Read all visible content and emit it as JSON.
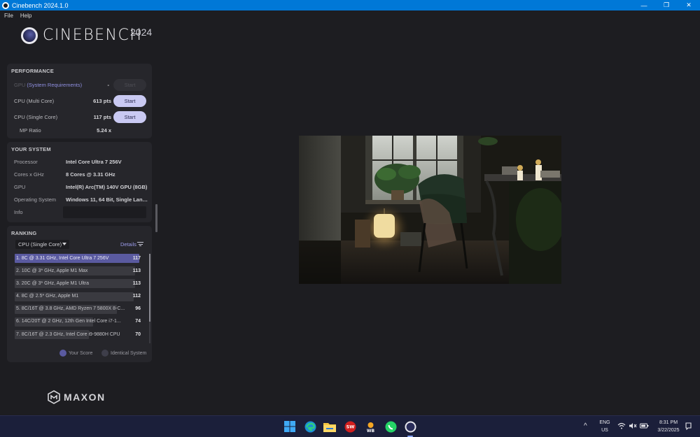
{
  "window": {
    "title": "Cinebench 2024.1.0",
    "controls": {
      "minimize": "—",
      "maximize": "❐",
      "close": "✕"
    }
  },
  "menu": {
    "items": [
      "File",
      "Help"
    ]
  },
  "logo": {
    "name": "CINEBENCH",
    "year": "2024"
  },
  "performance": {
    "title": "PERFORMANCE",
    "gpu": {
      "label_dim": "GPU",
      "label_link": " (System Requirements)",
      "score": "-",
      "button": "Start"
    },
    "cpu_multi": {
      "label": "CPU (Multi Core)",
      "score": "613 pts",
      "button": "Start"
    },
    "cpu_single": {
      "label": "CPU (Single Core)",
      "score": "117 pts",
      "button": "Start"
    },
    "mp_ratio": {
      "label": "MP Ratio",
      "score": "5.24 x"
    }
  },
  "system": {
    "title": "YOUR SYSTEM",
    "rows": [
      {
        "key": "Processor",
        "value": "Intel Core Ultra 7 256V"
      },
      {
        "key": "Cores x GHz",
        "value": "8 Cores @ 3.31 GHz"
      },
      {
        "key": "GPU",
        "value": "Intel(R) Arc(TM) 140V GPU (8GB)"
      },
      {
        "key": "Operating System",
        "value": "Windows 11, 64 Bit, Single Lang..."
      },
      {
        "key": "Info",
        "value": ""
      }
    ]
  },
  "ranking": {
    "title": "RANKING",
    "filter": "CPU (Single Core)",
    "details": "Details",
    "items": [
      {
        "name": "1. 8C @ 3.31 GHz, Intel Core Ultra 7 256V",
        "score": "117",
        "fraction": 1.0,
        "mine": true
      },
      {
        "name": "2. 10C @ 3* GHz, Apple M1 Max",
        "score": "113",
        "fraction": 0.966,
        "mine": false
      },
      {
        "name": "3. 20C @ 3* GHz, Apple M1 Ultra",
        "score": "113",
        "fraction": 0.966,
        "mine": false
      },
      {
        "name": "4. 8C @ 2.5* GHz, Apple M1",
        "score": "112",
        "fraction": 0.957,
        "mine": false
      },
      {
        "name": "5. 8C/16T @ 3.8 GHz, AMD Ryzen 7 5800X 8-C...",
        "score": "96",
        "fraction": 0.82,
        "mine": false
      },
      {
        "name": "6. 14C/20T @ 2 GHz, 12th Gen Intel Core i7-1...",
        "score": "74",
        "fraction": 0.632,
        "mine": false
      },
      {
        "name": "7. 8C/16T @ 2.3 GHz, Intel Core i9-9880H CPU",
        "score": "70",
        "fraction": 0.598,
        "mine": false
      }
    ],
    "legend": {
      "your_score": "Your Score",
      "identical": "Identical System"
    }
  },
  "brand": {
    "maxon": "MAXON"
  },
  "taskbar": {
    "lang": "ENG",
    "region": "US",
    "time": "8:31 PM",
    "date": "3/22/2025",
    "show_hidden_icon": "^"
  },
  "colors": {
    "accent": "#c9c9f2",
    "mine_bar": "#5a5aa0",
    "titlebar": "#0078d7",
    "taskbar": "#1b1f3a"
  }
}
